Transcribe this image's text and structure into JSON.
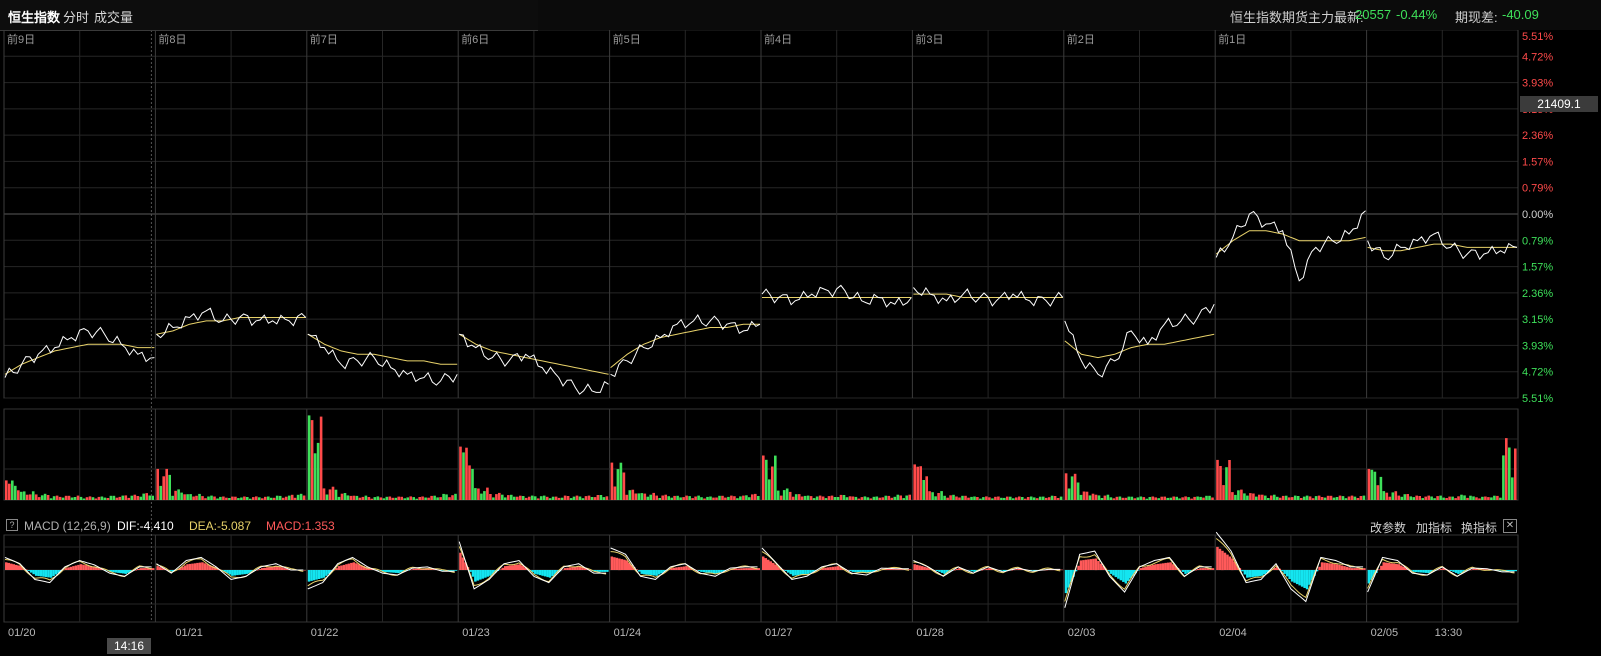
{
  "tabs": [
    {
      "label": "恒生指数",
      "active": true
    },
    {
      "label": "分时",
      "active": false
    },
    {
      "label": "成交量",
      "active": false
    }
  ],
  "quote": {
    "label": "恒生指数期货主力最新:",
    "price": "20557",
    "change": "-0.44%",
    "basis_label": "期现差:",
    "basis": "-40.09"
  },
  "colors": {
    "up": "#ff4a4a",
    "down": "#3ee05a",
    "price_line": "#ffffff",
    "avg_line": "#e8d26a",
    "macd_neg": "#14e5f0",
    "macd_pos": "#ff5a5a",
    "grid": "#262626",
    "session_divider": "#3b3b3b"
  },
  "macd_bar": {
    "title": "MACD (12,26,9)",
    "dif": "DIF:-4.410",
    "dea": "DEA:-5.087",
    "macd": "MACD:1.353",
    "buttons": [
      "改参数",
      "加指标",
      "换指标"
    ],
    "collapse_symbol": "?"
  },
  "hover": {
    "time": "14:16",
    "price": "21409.1"
  },
  "chart_data": {
    "type": "line",
    "title": "恒生指数",
    "session_labels": [
      "前9日",
      "前8日",
      "前7日",
      "前6日",
      "前5日",
      "前4日",
      "前3日",
      "前2日",
      "前1日",
      ""
    ],
    "dates": [
      "01/20",
      "01/21",
      "01/22",
      "01/23",
      "01/24",
      "01/27",
      "01/28",
      "02/03",
      "02/04",
      "02/05"
    ],
    "extra_time_label": "13:30",
    "y_pct_labels": [
      "5.51%",
      "4.72%",
      "3.93%",
      "3.15%",
      "2.36%",
      "1.57%",
      "0.79%",
      "0.00%",
      "0.79%",
      "1.57%",
      "2.36%",
      "3.15%",
      "3.93%",
      "4.72%",
      "5.51%"
    ],
    "y_pct_range": [
      -5.51,
      5.51
    ],
    "baseline_pct": 0.0,
    "series": [
      {
        "name": "price",
        "sessions": [
          [
            -4.9,
            -4.5,
            -4.2,
            -4.0,
            -3.7,
            -3.5,
            -3.6,
            -3.9,
            -4.2,
            -4.3
          ],
          [
            -3.6,
            -3.4,
            -3.1,
            -2.9,
            -3.2,
            -3.1,
            -3.2,
            -3.2,
            -3.2,
            -3.1
          ],
          [
            -3.6,
            -4.0,
            -4.5,
            -4.4,
            -4.3,
            -4.6,
            -4.8,
            -4.9,
            -5.0,
            -4.8
          ],
          [
            -3.6,
            -4.0,
            -4.3,
            -4.4,
            -4.2,
            -4.6,
            -4.9,
            -5.2,
            -5.3,
            -5.1
          ],
          [
            -4.8,
            -4.4,
            -4.0,
            -3.7,
            -3.3,
            -3.2,
            -3.2,
            -3.3,
            -3.5,
            -3.3
          ],
          [
            -2.4,
            -2.5,
            -2.6,
            -2.4,
            -2.3,
            -2.3,
            -2.6,
            -2.5,
            -2.7,
            -2.5
          ],
          [
            -2.2,
            -2.4,
            -2.6,
            -2.4,
            -2.5,
            -2.6,
            -2.4,
            -2.6,
            -2.6,
            -2.5
          ],
          [
            -3.2,
            -4.4,
            -4.8,
            -4.4,
            -3.5,
            -3.9,
            -3.3,
            -3.2,
            -3.1,
            -2.7
          ],
          [
            -1.3,
            -0.7,
            0.0,
            -0.3,
            -0.5,
            -2.0,
            -1.0,
            -0.8,
            -0.6,
            0.1
          ],
          [
            -0.8,
            -1.3,
            -1.0,
            -0.8,
            -0.6,
            -1.0,
            -1.2,
            -1.2,
            -1.1,
            -1.0
          ]
        ]
      },
      {
        "name": "avg",
        "sessions": [
          [
            -4.8,
            -4.5,
            -4.3,
            -4.1,
            -4.0,
            -3.9,
            -3.9,
            -3.9,
            -4.0,
            -4.0
          ],
          [
            -3.6,
            -3.5,
            -3.3,
            -3.2,
            -3.2,
            -3.1,
            -3.1,
            -3.1,
            -3.1,
            -3.1
          ],
          [
            -3.6,
            -3.9,
            -4.1,
            -4.2,
            -4.2,
            -4.3,
            -4.4,
            -4.4,
            -4.5,
            -4.5
          ],
          [
            -3.6,
            -3.9,
            -4.1,
            -4.2,
            -4.3,
            -4.4,
            -4.5,
            -4.6,
            -4.7,
            -4.8
          ],
          [
            -4.6,
            -4.2,
            -3.9,
            -3.7,
            -3.6,
            -3.5,
            -3.4,
            -3.4,
            -3.3,
            -3.3
          ],
          [
            -2.5,
            -2.5,
            -2.5,
            -2.5,
            -2.5,
            -2.5,
            -2.5,
            -2.5,
            -2.5,
            -2.5
          ],
          [
            -2.4,
            -2.4,
            -2.4,
            -2.5,
            -2.5,
            -2.5,
            -2.5,
            -2.5,
            -2.5,
            -2.5
          ],
          [
            -3.8,
            -4.2,
            -4.3,
            -4.2,
            -4.0,
            -3.9,
            -3.9,
            -3.8,
            -3.7,
            -3.6
          ],
          [
            -1.2,
            -0.8,
            -0.5,
            -0.5,
            -0.6,
            -0.8,
            -0.8,
            -0.8,
            -0.8,
            -0.7
          ],
          [
            -1.0,
            -1.1,
            -1.1,
            -1.0,
            -0.9,
            -0.9,
            -1.0,
            -1.0,
            -1.0,
            -1.0
          ]
        ]
      }
    ],
    "volume_sessions": [
      [
        0.22,
        0.1,
        0.07,
        0.05,
        0.05,
        0.04,
        0.04,
        0.05,
        0.06,
        0.08
      ],
      [
        0.35,
        0.12,
        0.07,
        0.05,
        0.04,
        0.04,
        0.04,
        0.04,
        0.05,
        0.07
      ],
      [
        0.95,
        0.15,
        0.08,
        0.05,
        0.04,
        0.04,
        0.04,
        0.04,
        0.05,
        0.07
      ],
      [
        0.6,
        0.14,
        0.08,
        0.06,
        0.05,
        0.05,
        0.04,
        0.05,
        0.05,
        0.06
      ],
      [
        0.42,
        0.12,
        0.08,
        0.06,
        0.05,
        0.05,
        0.04,
        0.05,
        0.05,
        0.07
      ],
      [
        0.5,
        0.13,
        0.07,
        0.05,
        0.05,
        0.06,
        0.04,
        0.04,
        0.05,
        0.06
      ],
      [
        0.4,
        0.1,
        0.06,
        0.05,
        0.04,
        0.04,
        0.04,
        0.04,
        0.04,
        0.05
      ],
      [
        0.3,
        0.1,
        0.06,
        0.04,
        0.04,
        0.04,
        0.04,
        0.04,
        0.04,
        0.05
      ],
      [
        0.45,
        0.12,
        0.08,
        0.06,
        0.05,
        0.05,
        0.05,
        0.05,
        0.05,
        0.05
      ],
      [
        0.35,
        0.1,
        0.07,
        0.05,
        0.05,
        0.04,
        0.06,
        0.04,
        0.05,
        0.7
      ]
    ],
    "macd_sessions": [
      [
        2.0,
        1.0,
        -1.5,
        -2.0,
        0.5,
        1.5,
        0.8,
        -0.5,
        -1.0,
        0.5
      ],
      [
        1.0,
        -0.5,
        1.5,
        2.0,
        0.5,
        -1.5,
        -1.0,
        0.5,
        1.0,
        0.0
      ],
      [
        -3.0,
        -2.0,
        1.0,
        2.0,
        0.5,
        -0.5,
        -0.8,
        0.3,
        0.5,
        -0.2
      ],
      [
        4.5,
        -3.0,
        -1.5,
        1.0,
        1.5,
        -1.0,
        -2.0,
        0.5,
        1.0,
        -0.5
      ],
      [
        3.5,
        2.5,
        -1.0,
        -1.5,
        0.5,
        1.0,
        -0.5,
        -1.0,
        0.3,
        0.5
      ],
      [
        3.5,
        1.0,
        -1.5,
        -1.0,
        0.5,
        1.0,
        -0.5,
        -0.8,
        0.3,
        0.2
      ],
      [
        1.5,
        0.5,
        -1.0,
        0.5,
        -0.5,
        0.5,
        -0.3,
        0.3,
        -0.2,
        0.1
      ],
      [
        -6.0,
        2.5,
        3.0,
        -1.0,
        -3.5,
        0.5,
        1.5,
        2.0,
        -1.0,
        0.5
      ],
      [
        6.0,
        3.0,
        -2.0,
        -1.5,
        1.0,
        -3.0,
        -5.0,
        2.0,
        1.5,
        0.5
      ],
      [
        -3.5,
        2.0,
        1.5,
        -0.5,
        -0.8,
        0.5,
        -1.0,
        0.3,
        0.2,
        -0.3
      ]
    ]
  }
}
